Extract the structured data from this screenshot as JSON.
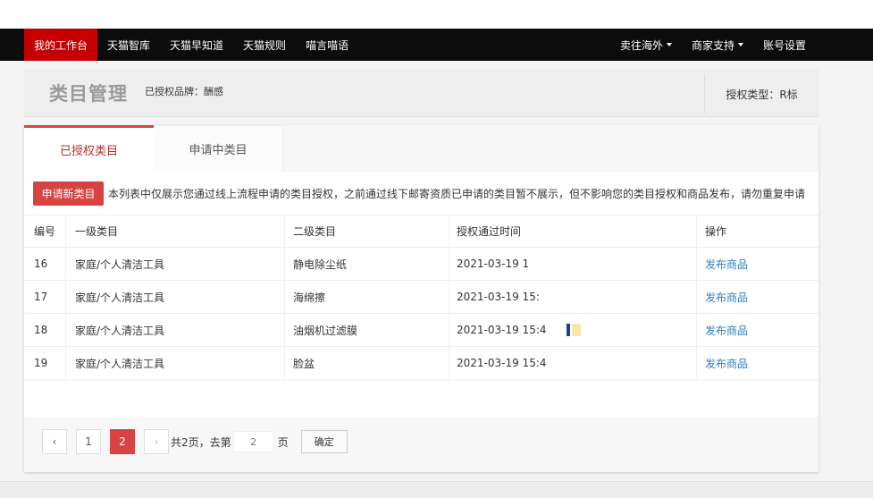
{
  "nav": {
    "left_items": [
      "我的工作台",
      "天猫智库",
      "天猫早知道",
      "天猫规则",
      "喵言喵语"
    ],
    "right_items": [
      {
        "label": "卖往海外",
        "dropdown": true
      },
      {
        "label": "商家支持",
        "dropdown": true
      },
      {
        "label": "账号设置",
        "dropdown": false
      }
    ],
    "active_color": "#c40000"
  },
  "header": {
    "title": "类目管理",
    "brand_label": "已授权品牌：酬感",
    "auth_type": "授权类型：R标"
  },
  "tabs": [
    {
      "label": "已授权类目",
      "active": true
    },
    {
      "label": "申请中类目",
      "active": false
    }
  ],
  "notice": {
    "apply_button": "申请新类目",
    "text": "本列表中仅展示您通过线上流程申请的类目授权，之前通过线下邮寄资质已申请的类目暂不展示，但不影响您的类目授权和商品发布，请勿重复申请"
  },
  "table": {
    "headers": [
      "编号",
      "一级类目",
      "二级类目",
      "授权通过时间",
      "操作"
    ],
    "rows": [
      {
        "id": "16",
        "level1": "家庭/个人清洁工具",
        "level2": "静电除尘纸",
        "time": "2021-03-19 1",
        "action": "发布商品"
      },
      {
        "id": "17",
        "level1": "家庭/个人清洁工具",
        "level2": "海绵擦",
        "time": "2021-03-19 15:",
        "action": "发布商品"
      },
      {
        "id": "18",
        "level1": "家庭/个人清洁工具",
        "level2": "油烟机过滤膜",
        "time": "2021-03-19 15:4",
        "action": "发布商品"
      },
      {
        "id": "19",
        "level1": "家庭/个人清洁工具",
        "level2": "脸盆",
        "time": "2021-03-19 15:4",
        "action": "发布商品"
      }
    ]
  },
  "pagination": {
    "prev_icon": "‹",
    "pages": [
      "1",
      "2"
    ],
    "current_page": "2",
    "next_icon": "›",
    "total_text": "共2页，去第",
    "input_value": "2",
    "page_suffix": "页",
    "confirm_label": "确定"
  },
  "colors": {
    "brand_red": "#d94242",
    "link_blue": "#2a7fc1",
    "nav_bg": "#0c0c0c"
  }
}
